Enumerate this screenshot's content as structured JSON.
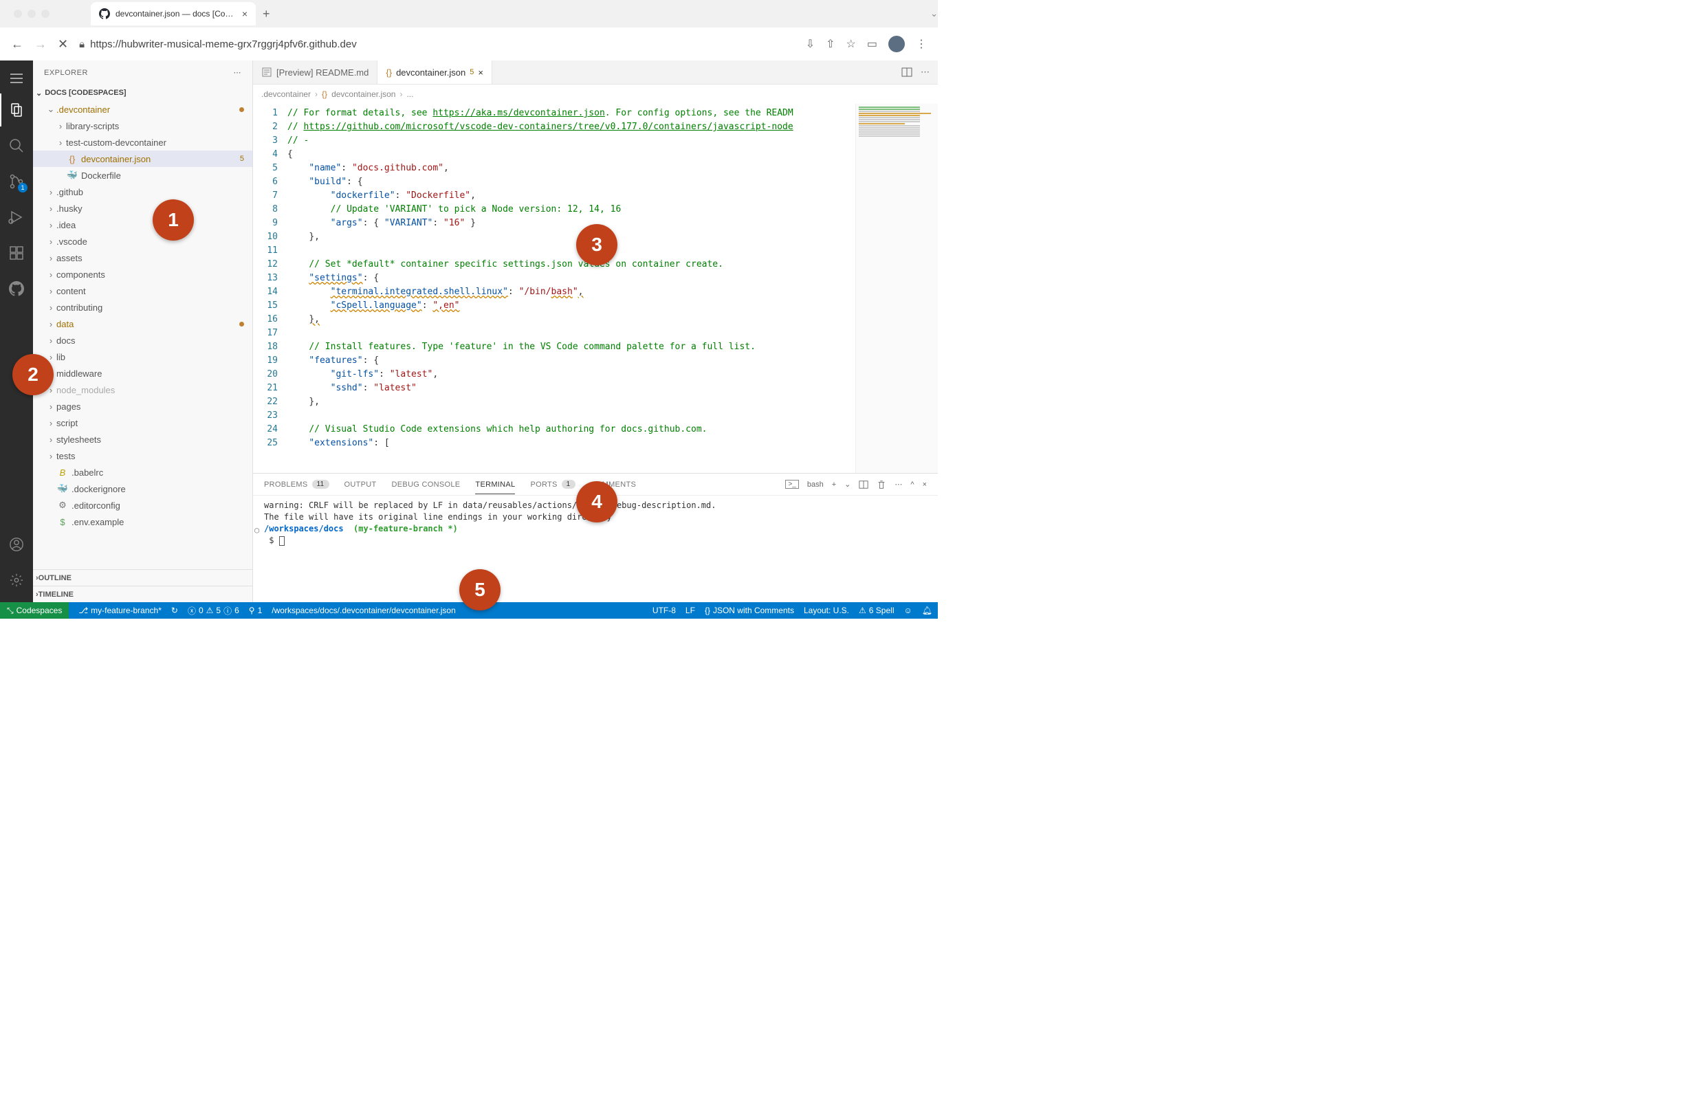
{
  "browser": {
    "tab_title": "devcontainer.json — docs [Cod…",
    "url": "https://hubwriter-musical-meme-grx7rggrj4pfv6r.github.dev"
  },
  "activity": {
    "scm_badge": "1"
  },
  "sidebar": {
    "title": "EXPLORER",
    "workspace": "DOCS [CODESPACES]",
    "tree": [
      {
        "depth": 1,
        "kind": "folder",
        "open": true,
        "label": ".devcontainer",
        "mod": true,
        "dot": true
      },
      {
        "depth": 2,
        "kind": "folder",
        "open": false,
        "label": "library-scripts"
      },
      {
        "depth": 2,
        "kind": "folder",
        "open": false,
        "label": "test-custom-devcontainer"
      },
      {
        "depth": 2,
        "kind": "file",
        "icon": "{}",
        "icon_color": "#c08030",
        "label": "devcontainer.json",
        "mod": true,
        "selected": true,
        "badge": "5"
      },
      {
        "depth": 2,
        "kind": "file",
        "icon": "🐳",
        "label": "Dockerfile"
      },
      {
        "depth": 1,
        "kind": "folder",
        "open": false,
        "label": ".github"
      },
      {
        "depth": 1,
        "kind": "folder",
        "open": false,
        "label": ".husky"
      },
      {
        "depth": 1,
        "kind": "folder",
        "open": false,
        "label": ".idea"
      },
      {
        "depth": 1,
        "kind": "folder",
        "open": false,
        "label": ".vscode"
      },
      {
        "depth": 1,
        "kind": "folder",
        "open": false,
        "label": "assets"
      },
      {
        "depth": 1,
        "kind": "folder",
        "open": false,
        "label": "components"
      },
      {
        "depth": 1,
        "kind": "folder",
        "open": false,
        "label": "content"
      },
      {
        "depth": 1,
        "kind": "folder",
        "open": false,
        "label": "contributing"
      },
      {
        "depth": 1,
        "kind": "folder",
        "open": false,
        "label": "data",
        "mod": true,
        "dot": true
      },
      {
        "depth": 1,
        "kind": "folder",
        "open": false,
        "label": "docs"
      },
      {
        "depth": 1,
        "kind": "folder",
        "open": false,
        "label": "lib"
      },
      {
        "depth": 1,
        "kind": "folder",
        "open": false,
        "label": "middleware"
      },
      {
        "depth": 1,
        "kind": "folder",
        "open": false,
        "label": "node_modules",
        "dimmed": true
      },
      {
        "depth": 1,
        "kind": "folder",
        "open": false,
        "label": "pages"
      },
      {
        "depth": 1,
        "kind": "folder",
        "open": false,
        "label": "script"
      },
      {
        "depth": 1,
        "kind": "folder",
        "open": false,
        "label": "stylesheets"
      },
      {
        "depth": 1,
        "kind": "folder",
        "open": false,
        "label": "tests"
      },
      {
        "depth": 1,
        "kind": "file",
        "icon": "B",
        "icon_color": "#c0a000",
        "italic": true,
        "label": ".babelrc"
      },
      {
        "depth": 1,
        "kind": "file",
        "icon": "🐳",
        "dimmed_icon": true,
        "label": ".dockerignore"
      },
      {
        "depth": 1,
        "kind": "file",
        "icon": "⚙",
        "icon_color": "#777",
        "label": ".editorconfig"
      },
      {
        "depth": 1,
        "kind": "file",
        "icon": "$",
        "icon_color": "#5a9e5a",
        "label": ".env.example"
      }
    ],
    "outline": "OUTLINE",
    "timeline": "TIMELINE"
  },
  "tabs": {
    "preview": {
      "label": "[Preview] README.md"
    },
    "active": {
      "icon": "{}",
      "label": "devcontainer.json",
      "badge": "5"
    }
  },
  "breadcrumb": {
    "a": ".devcontainer",
    "b": "devcontainer.json",
    "c": "..."
  },
  "code_lines": [
    {
      "n": 1,
      "cls": "",
      "html": "<span class='c-comment'>// For format details, see <span class='c-link'>https://aka.ms/devcontainer.json</span>. For config options, see the READM</span>"
    },
    {
      "n": 2,
      "cls": "",
      "html": "<span class='c-comment'>// <span class='c-link'>https://github.com/microsoft/vscode-dev-containers/tree/v0.177.0/containers/javascript-node</span></span>"
    },
    {
      "n": 3,
      "cls": "",
      "html": "<span class='c-comment'>// -</span>"
    },
    {
      "n": 4,
      "cls": "",
      "html": "<span class='c-punc'>{</span>"
    },
    {
      "n": 5,
      "cls": "",
      "html": "    <span class='c-key'>\"name\"</span><span class='c-punc'>:</span> <span class='c-string'>\"docs.github.com\"</span><span class='c-punc'>,</span>"
    },
    {
      "n": 6,
      "cls": "",
      "html": "    <span class='c-key'>\"build\"</span><span class='c-punc'>:</span> <span class='c-punc'>{</span>"
    },
    {
      "n": 7,
      "cls": "",
      "html": "        <span class='c-key'>\"dockerfile\"</span><span class='c-punc'>:</span> <span class='c-string'>\"Dockerfile\"</span><span class='c-punc'>,</span>"
    },
    {
      "n": 8,
      "cls": "",
      "html": "        <span class='c-comment'>// Update 'VARIANT' to pick a Node version: 12, 14, 16</span>"
    },
    {
      "n": 9,
      "cls": "",
      "html": "        <span class='c-key'>\"args\"</span><span class='c-punc'>:</span> <span class='c-punc'>{</span> <span class='c-key'>\"VARIANT\"</span><span class='c-punc'>:</span> <span class='c-string'>\"16\"</span> <span class='c-punc'>}</span>"
    },
    {
      "n": 10,
      "cls": "",
      "html": "    <span class='c-punc'>},</span>"
    },
    {
      "n": 11,
      "cls": "",
      "html": ""
    },
    {
      "n": 12,
      "cls": "",
      "html": "    <span class='c-comment'>// Set *default* container specific settings.json values on container create.</span>"
    },
    {
      "n": 13,
      "cls": "",
      "html": "    <span class='c-key wavy'>\"settings\"</span><span class='c-punc'>:</span> <span class='c-punc'>{</span>"
    },
    {
      "n": 14,
      "cls": "",
      "html": "        <span class='c-key wavy'>\"terminal.integrated.shell.linux\"</span><span class='c-punc'>:</span> <span class='c-string'>\"/bin/<span class='wavy'>bash</span>\"</span><span class='c-punc wavy'>,</span>"
    },
    {
      "n": 15,
      "cls": "",
      "html": "        <span class='c-key wavy'>\"cSpell.language\"</span><span class='c-punc'>:</span> <span class='c-string wavy'>\",en\"</span>"
    },
    {
      "n": 16,
      "cls": "",
      "html": "    <span class='c-punc wavy'>},</span>"
    },
    {
      "n": 17,
      "cls": "",
      "html": ""
    },
    {
      "n": 18,
      "cls": "",
      "html": "    <span class='c-comment'>// Install features. Type 'feature' in the VS Code command palette for a full list.</span>"
    },
    {
      "n": 19,
      "cls": "",
      "html": "    <span class='c-key'>\"features\"</span><span class='c-punc'>:</span> <span class='c-punc'>{</span>"
    },
    {
      "n": 20,
      "cls": "",
      "html": "        <span class='c-key'>\"git-lfs\"</span><span class='c-punc'>:</span> <span class='c-string'>\"latest\"</span><span class='c-punc'>,</span>"
    },
    {
      "n": 21,
      "cls": "",
      "html": "        <span class='c-key'>\"sshd\"</span><span class='c-punc'>:</span> <span class='c-string'>\"latest\"</span>"
    },
    {
      "n": 22,
      "cls": "",
      "html": "    <span class='c-punc'>},</span>"
    },
    {
      "n": 23,
      "cls": "",
      "html": ""
    },
    {
      "n": 24,
      "cls": "",
      "html": "    <span class='c-comment'>// Visual Studio Code extensions which help authoring for docs.github.com.</span>"
    },
    {
      "n": 25,
      "cls": "",
      "html": "    <span class='c-key'>\"extensions\"</span><span class='c-punc'>:</span> <span class='c-punc'>[</span>"
    }
  ],
  "panel": {
    "tabs": {
      "problems": {
        "label": "PROBLEMS",
        "count": "11"
      },
      "output": {
        "label": "OUTPUT"
      },
      "debug": {
        "label": "DEBUG CONSOLE"
      },
      "terminal": {
        "label": "TERMINAL"
      },
      "ports": {
        "label": "PORTS",
        "count": "1"
      },
      "comments": {
        "label": "COMMENTS"
      }
    },
    "actions": {
      "shell": "bash"
    },
    "terminal_lines": {
      "l1": "warning: CRLF will be replaced by LF in data/reusables/actions/runner-debug-description.md.",
      "l2": "The file will have its original line endings in your working directory",
      "path": "/workspaces/docs",
      "branch": "(my-feature-branch *)",
      "prompt": "$ "
    }
  },
  "status": {
    "codespaces": "Codespaces",
    "branch": "my-feature-branch*",
    "sync": "↻",
    "errors": "0",
    "warnings": "5",
    "infos": "6",
    "ports": "1",
    "path": "/workspaces/docs/.devcontainer/devcontainer.json",
    "encoding": "UTF-8",
    "eol": "LF",
    "lang": "JSON with Comments",
    "layout": "Layout: U.S.",
    "spell": "6 Spell"
  },
  "callouts": [
    "1",
    "2",
    "3",
    "4",
    "5"
  ]
}
